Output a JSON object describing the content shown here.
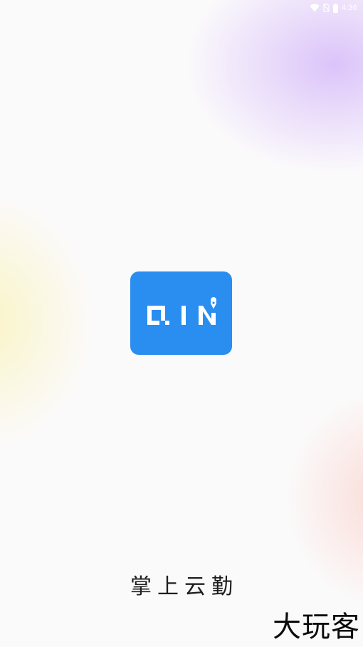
{
  "status_bar": {
    "time": "4:36",
    "icons": [
      "wifi-icon",
      "no-sim-icon",
      "battery-icon"
    ]
  },
  "logo": {
    "text": "QIN",
    "tile_color": "#2a8df0",
    "glyph_color": "#ffffff"
  },
  "app_name": "掌上云勤",
  "watermark": "大玩客"
}
